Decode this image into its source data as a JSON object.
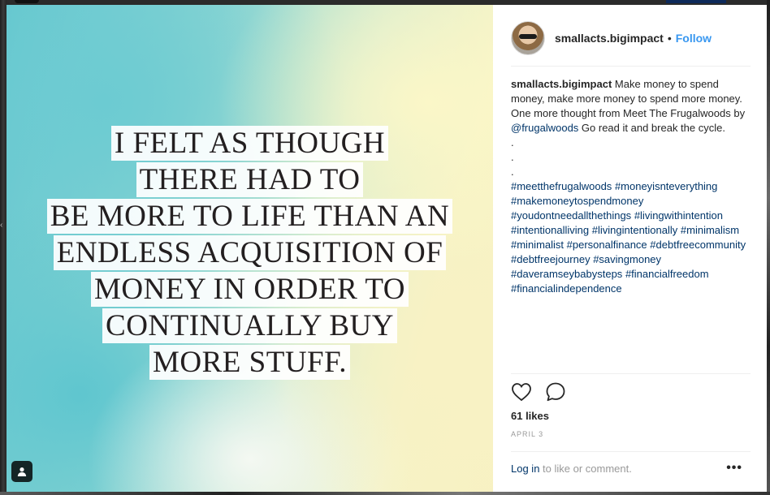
{
  "post": {
    "quote_lines": [
      "I FELT AS THOUGH",
      "THERE HAD TO",
      "BE MORE TO LIFE THAN AN",
      "ENDLESS ACQUISITION OF",
      "MONEY IN ORDER TO",
      "CONTINUALLY BUY",
      "MORE STUFF."
    ]
  },
  "header": {
    "username": "smallacts.bigimpact",
    "separator": "•",
    "follow_label": "Follow"
  },
  "caption": {
    "username": "smallacts.bigimpact",
    "text_before_mention": "Make money to spend money, make more money to spend more money. One more thought from Meet The Frugalwoods by",
    "mention": "@frugalwoods",
    "text_after_mention": "Go read it and break the cycle.",
    "dots": [
      ".",
      ".",
      "."
    ],
    "hashtags": [
      "#meetthefrugalwoods",
      "#moneyisnteverything",
      "#makemoneytospendmoney",
      "#youdontneedallthethings",
      "#livingwithintention",
      "#intentionalliving",
      "#livingintentionally",
      "#minimalism",
      "#minimalist",
      "#personalfinance",
      "#debtfreecommunity",
      "#debtfreejourney",
      "#savingmoney",
      "#daveramseybabysteps",
      "#financialfreedom",
      "#financialindependence"
    ]
  },
  "stats": {
    "likes": "61 likes",
    "date": "APRIL 3"
  },
  "footer": {
    "login_link": "Log in",
    "login_text": "to like or comment.",
    "more_label": "•••"
  },
  "colors": {
    "link": "#003569",
    "follow": "#3897f0",
    "muted": "#999999"
  },
  "icons": {
    "like": "heart-icon",
    "comment": "comment-icon",
    "more": "more-options-icon",
    "profile_tag": "tagged-user-icon"
  }
}
